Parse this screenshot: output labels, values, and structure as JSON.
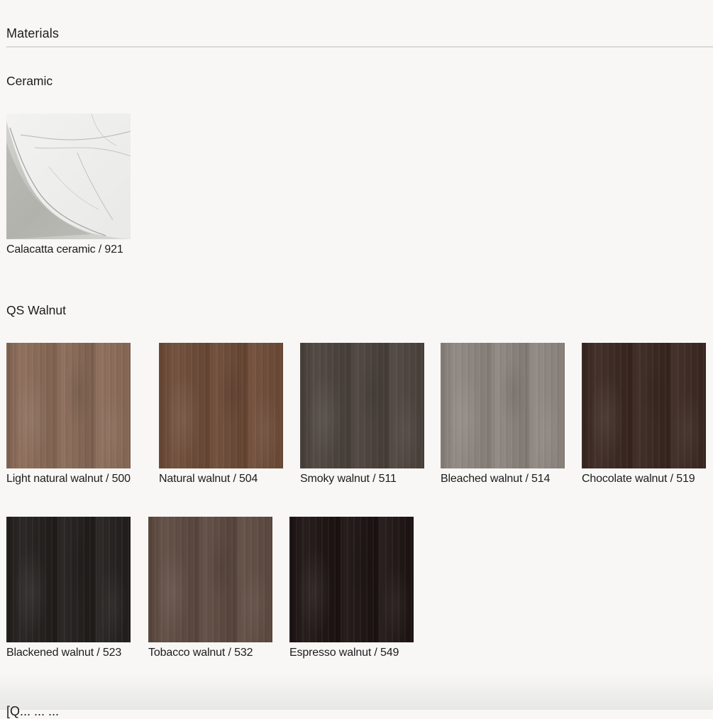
{
  "section": {
    "title": "Materials"
  },
  "groups": [
    {
      "title": "Ceramic",
      "items": [
        {
          "label": "Calacatta ceramic / 921",
          "color": "#eeeeec"
        }
      ]
    },
    {
      "title": "QS Walnut",
      "items": [
        {
          "label": "Light natural walnut / 500",
          "color": "#8a6a56"
        },
        {
          "label": "Natural walnut / 504",
          "color": "#6e4a36"
        },
        {
          "label": "Smoky walnut / 511",
          "color": "#4b423c"
        },
        {
          "label": "Bleached walnut / 514",
          "color": "#8e8680"
        },
        {
          "label": "Chocolate walnut / 519",
          "color": "#3a2620"
        },
        {
          "label": "Blackened walnut / 523",
          "color": "#211d1b"
        },
        {
          "label": "Tobacco walnut / 532",
          "color": "#5e4a40"
        },
        {
          "label": "Espresso walnut / 549",
          "color": "#1c1311"
        }
      ]
    }
  ],
  "next_section": {
    "title": "[Q... ... ..."
  }
}
